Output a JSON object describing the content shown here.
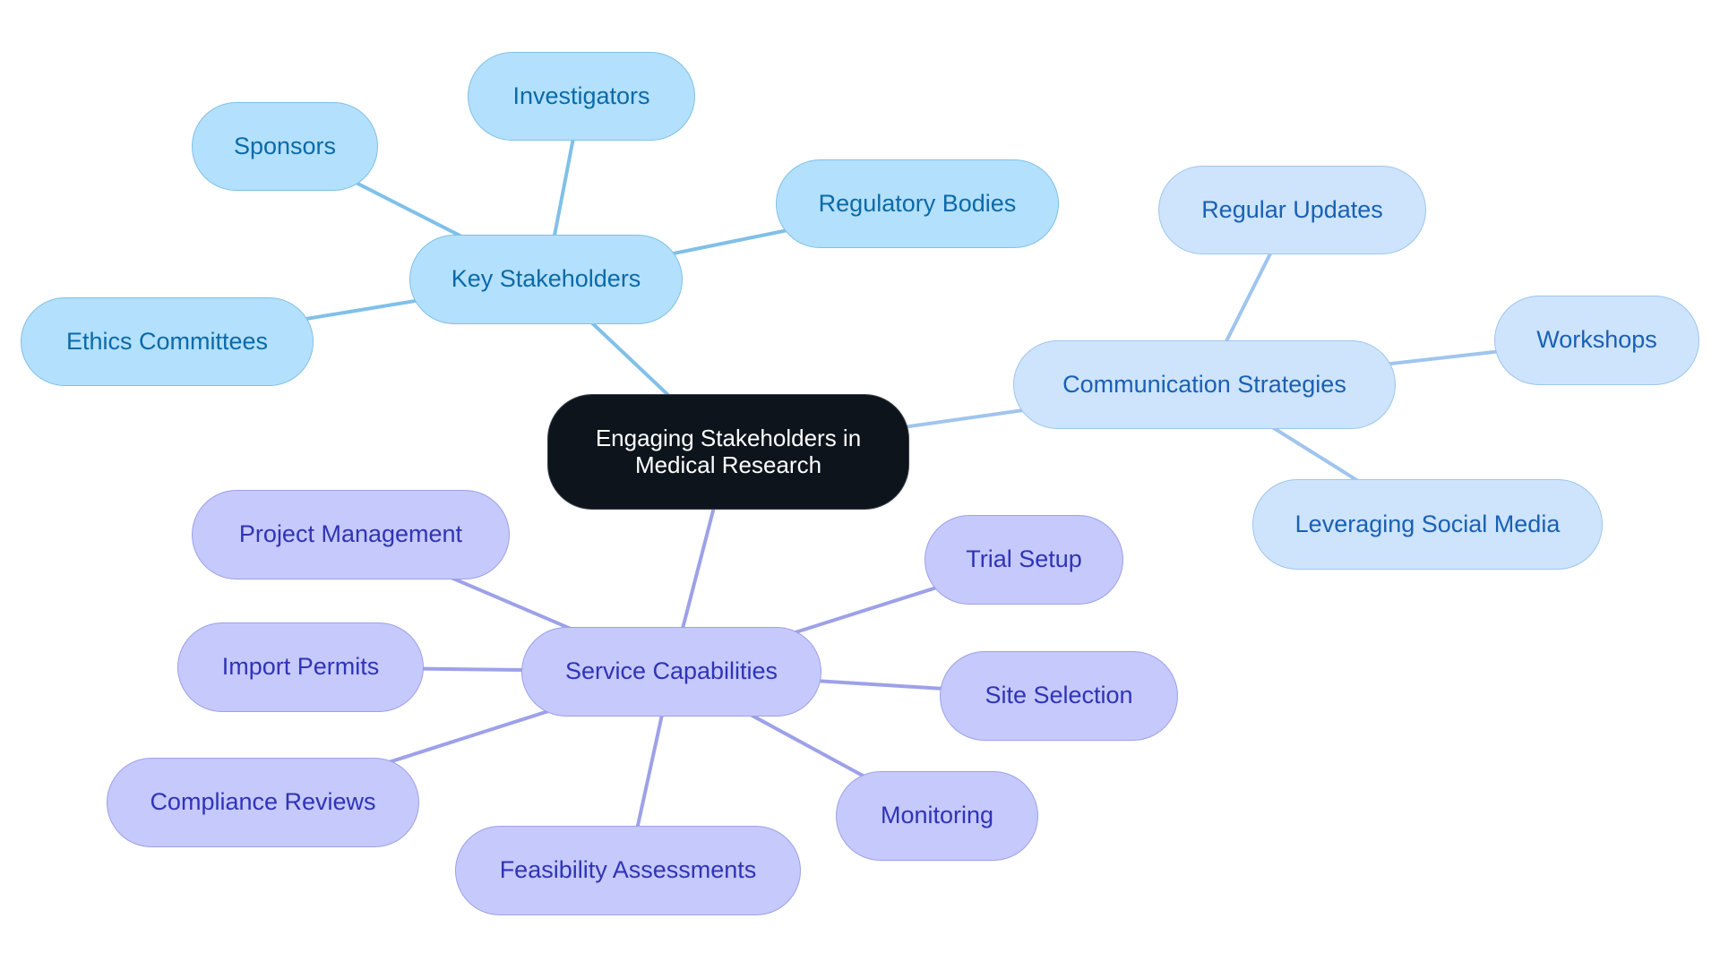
{
  "diagram": {
    "type": "mind-map",
    "colors": {
      "root_fill": "#0d141c",
      "root_text": "#ffffff",
      "stakeholders_fill": "#b3e0fc",
      "stakeholders_line": "#80c0e8",
      "stakeholders_text": "#0b6aa8",
      "communication_fill": "#cde4fc",
      "communication_line": "#9fc5ee",
      "communication_text": "#1a60b4",
      "services_fill": "#c6c9fc",
      "services_line": "#9da1e8",
      "services_text": "#2f34b6"
    },
    "root": {
      "id": "root",
      "label": "Engaging Stakeholders in\nMedical Research"
    },
    "branches": [
      {
        "id": "key-stakeholders",
        "label": "Key Stakeholders",
        "group": "stake",
        "children": [
          {
            "id": "sponsors",
            "label": "Sponsors"
          },
          {
            "id": "investigators",
            "label": "Investigators"
          },
          {
            "id": "regulatory-bodies",
            "label": "Regulatory Bodies"
          },
          {
            "id": "ethics-committees",
            "label": "Ethics Committees"
          }
        ]
      },
      {
        "id": "communication-strategies",
        "label": "Communication Strategies",
        "group": "comm",
        "children": [
          {
            "id": "regular-updates",
            "label": "Regular Updates"
          },
          {
            "id": "workshops",
            "label": "Workshops"
          },
          {
            "id": "leveraging-social-media",
            "label": "Leveraging Social Media"
          }
        ]
      },
      {
        "id": "service-capabilities",
        "label": "Service Capabilities",
        "group": "serv",
        "children": [
          {
            "id": "project-management",
            "label": "Project Management"
          },
          {
            "id": "import-permits",
            "label": "Import Permits"
          },
          {
            "id": "compliance-reviews",
            "label": "Compliance Reviews"
          },
          {
            "id": "feasibility-assessments",
            "label": "Feasibility Assessments"
          },
          {
            "id": "monitoring",
            "label": "Monitoring"
          },
          {
            "id": "site-selection",
            "label": "Site Selection"
          },
          {
            "id": "trial-setup",
            "label": "Trial Setup"
          }
        ]
      }
    ]
  }
}
